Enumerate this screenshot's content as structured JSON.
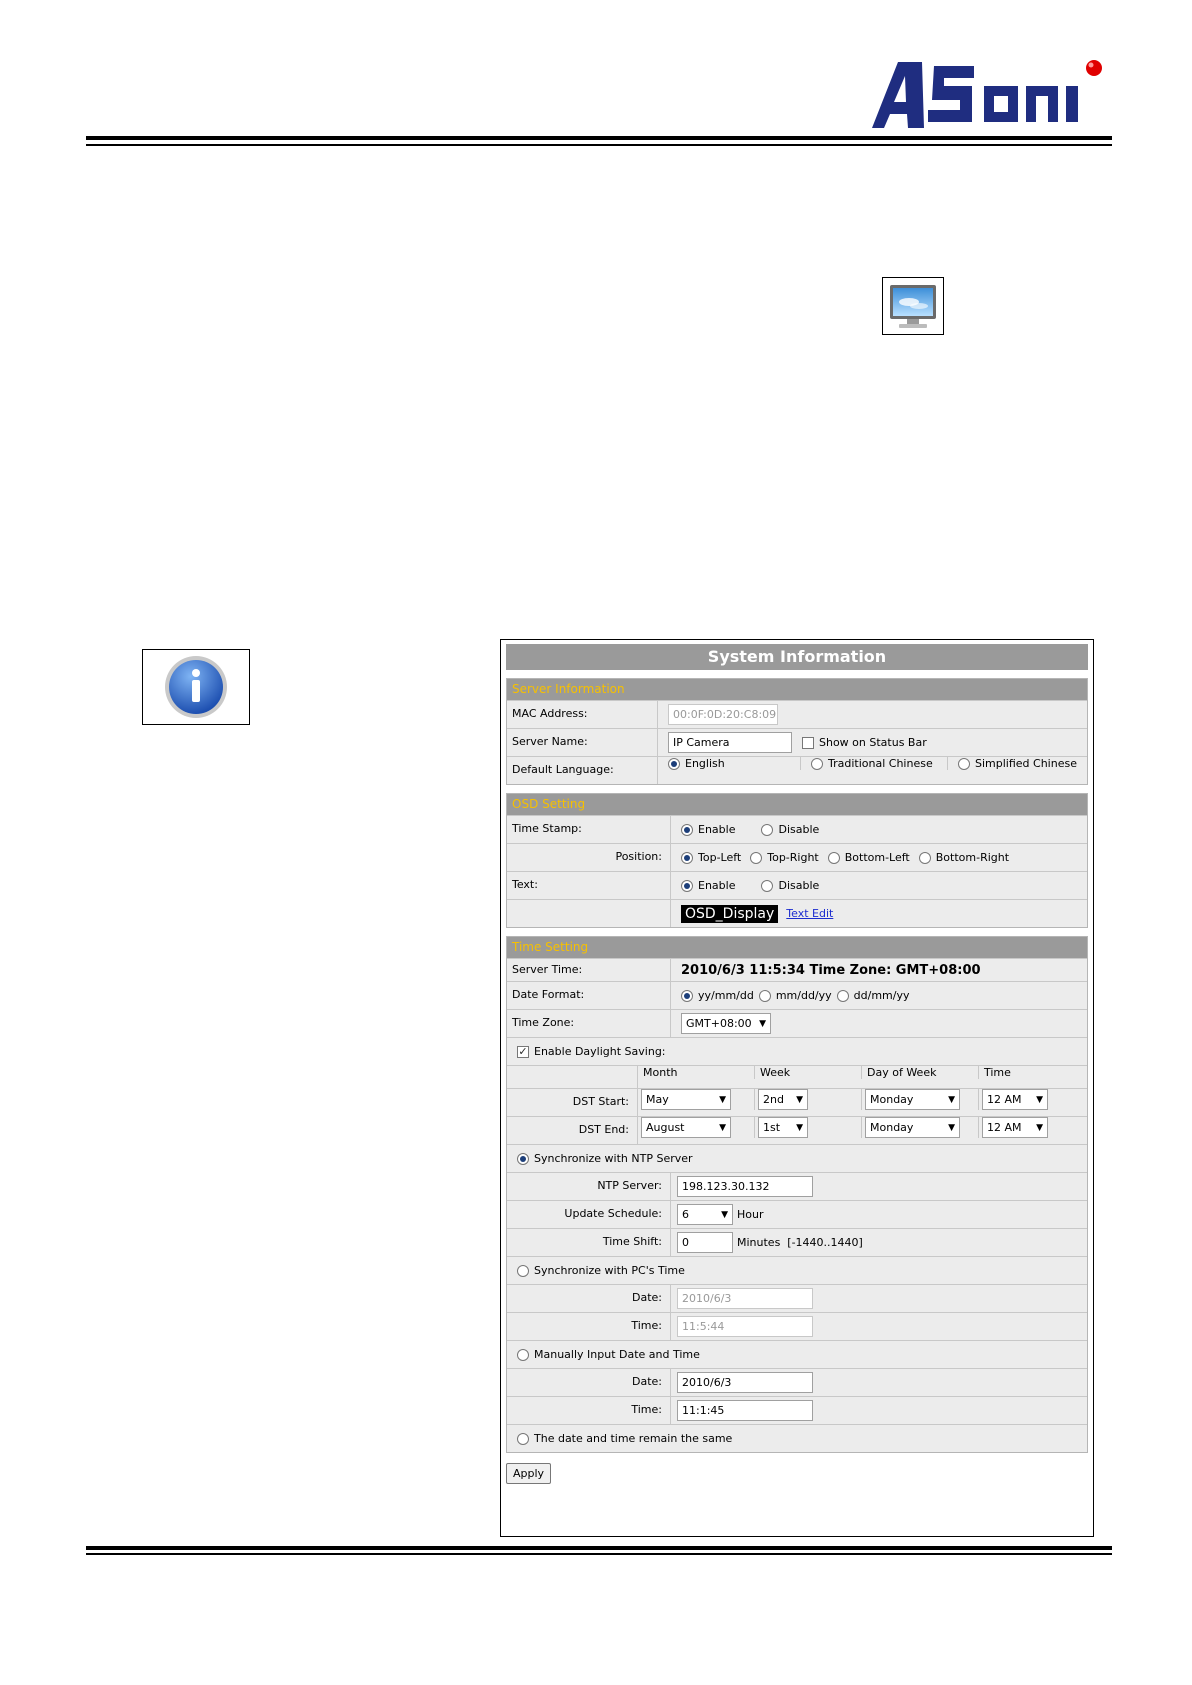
{
  "brand": {
    "logo_text": "Asoni"
  },
  "system_information": {
    "title": "System Information",
    "server_information": {
      "header": "Server Information",
      "mac_label": "MAC Address:",
      "mac_value": "00:0F:0D:20:C8:09",
      "server_name_label": "Server Name:",
      "server_name_value": "IP Camera",
      "show_on_status_bar": "Show on Status Bar",
      "default_language_label": "Default Language:",
      "lang_english": "English",
      "lang_traditional": "Traditional Chinese",
      "lang_simplified": "Simplified Chinese"
    },
    "osd_setting": {
      "header": "OSD Setting",
      "time_stamp_label": "Time Stamp:",
      "enable": "Enable",
      "disable": "Disable",
      "position_label": "Position:",
      "pos_top_left": "Top-Left",
      "pos_top_right": "Top-Right",
      "pos_bottom_left": "Bottom-Left",
      "pos_bottom_right": "Bottom-Right",
      "text_label": "Text:",
      "osd_text": "OSD_Display",
      "text_edit": "Text Edit"
    },
    "time_setting": {
      "header": "Time Setting",
      "server_time_label": "Server Time:",
      "server_time_value": "2010/6/3 11:5:34 Time Zone: GMT+08:00",
      "date_format_label": "Date Format:",
      "fmt_1": "yy/mm/dd",
      "fmt_2": "mm/dd/yy",
      "fmt_3": "dd/mm/yy",
      "time_zone_label": "Time Zone:",
      "time_zone_value": "GMT+08:00",
      "daylight_saving": "Enable Daylight Saving:",
      "col_month": "Month",
      "col_week": "Week",
      "col_day": "Day of Week",
      "col_time": "Time",
      "dst_start_label": "DST Start:",
      "dst_start_month": "May",
      "dst_start_week": "2nd",
      "dst_start_day": "Monday",
      "dst_start_time": "12 AM",
      "dst_end_label": "DST End:",
      "dst_end_month": "August",
      "dst_end_week": "1st",
      "dst_end_day": "Monday",
      "dst_end_time": "12 AM",
      "sync_ntp": "Synchronize with NTP Server",
      "ntp_server_label": "NTP Server:",
      "ntp_server_value": "198.123.30.132",
      "update_schedule_label": "Update Schedule:",
      "update_schedule_value": "6",
      "hour": "Hour",
      "time_shift_label": "Time Shift:",
      "time_shift_value": "0",
      "minutes_range": "Minutes  [-1440..1440]",
      "sync_pc": "Synchronize with PC's Time",
      "date_label": "Date:",
      "time_label": "Time:",
      "pc_date": "2010/6/3",
      "pc_time": "11:5:44",
      "manual": "Manually Input Date and Time",
      "manual_date": "2010/6/3",
      "manual_time": "11:1:45",
      "remain_same": "The date and time remain the same"
    },
    "apply": "Apply"
  }
}
